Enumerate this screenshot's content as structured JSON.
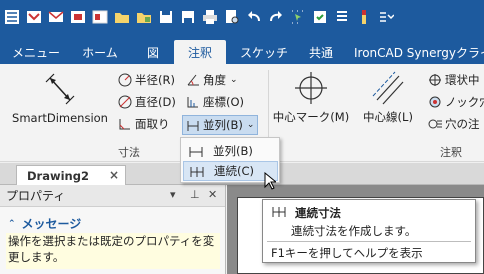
{
  "quick_access": {
    "icons": [
      "app-menu-icon",
      "open-icon",
      "mail-icon",
      "scene-icon",
      "window-icon",
      "folder-open-icon",
      "folder-icon",
      "save-icon",
      "save-all-icon",
      "print-icon",
      "print-preview-icon",
      "undo-icon",
      "redo-icon",
      "selection-icon",
      "move-icon",
      "properties-icon",
      "options-icon",
      "more-icon"
    ]
  },
  "tabs": [
    "メニュー",
    "ホーム",
    "図",
    "注釈",
    "スケッチ",
    "共通",
    "IronCAD Synergyクライア"
  ],
  "active_tab_index": 3,
  "ribbon": {
    "smart_dimension": "SmartDimension",
    "radius": "半径(R)",
    "diameter": "直径(D)",
    "chamfer": "面取り",
    "angle": "角度",
    "coordinate": "座標(O)",
    "parallel_menu": "並列(B)",
    "group_dimension": "寸法",
    "center_mark": "中心マーク(M)",
    "center_line": "中心線(L)",
    "ring_center": "環状中",
    "knock_hole": "ノック穴",
    "hole_info": "穴の注",
    "group_annotation": "注釈"
  },
  "dropdown": {
    "items": [
      "並列(B)",
      "連続(C)"
    ],
    "highlighted_index": 1
  },
  "document_tab": "Drawing2",
  "properties_panel": {
    "title": "プロパティ",
    "message_title": "メッセージ",
    "message_body": "操作を選択または既定のプロパティを変更します。"
  },
  "tooltip": {
    "title": "連続寸法",
    "description": "連続寸法を作成します。",
    "help": "F1キーを押してヘルプを表示"
  },
  "colors": {
    "ribbon_blue": "#1d5a9e",
    "message_bg": "#fffde0",
    "highlight": "#d8e6f5"
  }
}
